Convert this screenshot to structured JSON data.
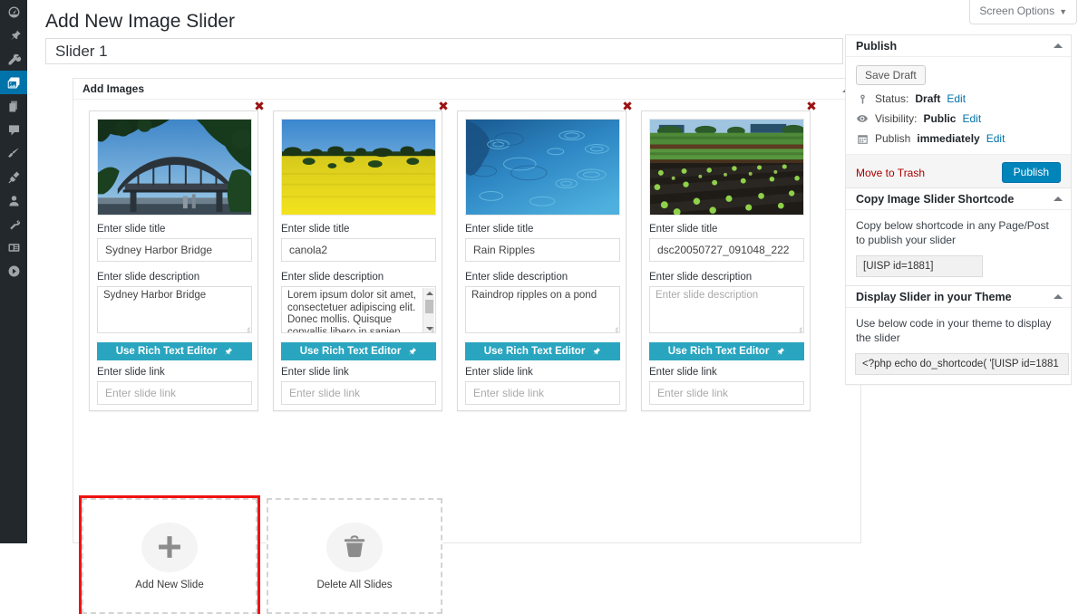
{
  "admin_menu": {
    "items": [
      {
        "name": "dashboard",
        "icon": "dashboard-icon",
        "current": false
      },
      {
        "name": "posts",
        "icon": "pin-icon",
        "current": false
      },
      {
        "name": "media",
        "icon": "media-icon",
        "current": false
      },
      {
        "name": "image-slider",
        "icon": "image-slider-icon",
        "current": true
      },
      {
        "name": "pages",
        "icon": "pages-icon",
        "current": false
      },
      {
        "name": "comments",
        "icon": "comment-icon",
        "current": false
      },
      {
        "name": "appearance",
        "icon": "paintbrush-icon",
        "current": false
      },
      {
        "name": "plugins",
        "icon": "plug-icon",
        "current": false
      },
      {
        "name": "users",
        "icon": "user-icon",
        "current": false
      },
      {
        "name": "tools",
        "icon": "wrench-icon",
        "current": false
      },
      {
        "name": "settings",
        "icon": "settings-icon",
        "current": false
      },
      {
        "name": "collapse-menu",
        "icon": "collapse-icon",
        "current": false
      }
    ]
  },
  "screen_options": {
    "label": "Screen Options",
    "caret": "▼"
  },
  "page": {
    "title": "Add New Image Slider"
  },
  "title_field": {
    "value": "Slider 1"
  },
  "add_images_box": {
    "heading": "Add Images"
  },
  "labels": {
    "title": "Enter slide title",
    "description": "Enter slide description",
    "link": "Enter slide link",
    "rich_text_editor": "Use Rich Text Editor",
    "delete_x": "✖"
  },
  "slides": [
    {
      "image_alt": "sydney-harbour-bridge-photo",
      "title_value": "Sydney Harbor Bridge",
      "description_value": "Sydney Harbor Bridge",
      "description_is_placeholder": false,
      "has_scrollbar": false,
      "link_value": "Enter slide link",
      "link_is_placeholder": true
    },
    {
      "image_alt": "canola-field-photo",
      "title_value": "canola2",
      "description_value": "Lorem ipsum dolor sit amet, consectetuer adipiscing elit. Donec mollis. Quisque convallis libero in sapien",
      "description_is_placeholder": false,
      "has_scrollbar": true,
      "link_value": "Enter slide link",
      "link_is_placeholder": true
    },
    {
      "image_alt": "rain-ripples-on-water-photo",
      "title_value": "Rain Ripples",
      "description_value": "Raindrop ripples on a pond",
      "description_is_placeholder": false,
      "has_scrollbar": false,
      "link_value": "Enter slide link",
      "link_is_placeholder": true
    },
    {
      "image_alt": "lettuce-field-rows-photo",
      "title_value": "dsc20050727_091048_222",
      "description_value": "Enter slide description",
      "description_is_placeholder": true,
      "has_scrollbar": false,
      "link_value": "Enter slide link",
      "link_is_placeholder": true
    }
  ],
  "tiles": {
    "add_new_slide": {
      "label": "Add New Slide",
      "icon": "plus-icon",
      "selected": true
    },
    "delete_all_slides": {
      "label": "Delete All Slides",
      "icon": "trash-icon",
      "selected": false
    }
  },
  "publish_box": {
    "heading": "Publish",
    "save_draft": "Save Draft",
    "status_label": "Status:",
    "status_value": "Draft",
    "status_edit": "Edit",
    "visibility_label": "Visibility:",
    "visibility_value": "Public",
    "visibility_edit": "Edit",
    "publish_label": "Publish",
    "publish_value": "immediately",
    "publish_edit": "Edit",
    "move_to_trash": "Move to Trash",
    "publish_button": "Publish"
  },
  "shortcode_box": {
    "heading": "Copy Image Slider Shortcode",
    "description": "Copy below shortcode in any Page/Post to publish your slider",
    "code": "[UISP id=1881]"
  },
  "theme_box": {
    "heading": "Display Slider in your Theme",
    "description": "Use below code in your theme to display the slider",
    "code": "<?php echo do_shortcode( '[UISP id=1881"
  },
  "colors": {
    "admin_bg": "#23282d",
    "accent_teal": "#29a5c0",
    "publish_blue": "#0085ba",
    "link_blue": "#0073aa",
    "delete_red": "#9b1111",
    "selection_red": "#f01111",
    "trash_red": "#a00000"
  }
}
